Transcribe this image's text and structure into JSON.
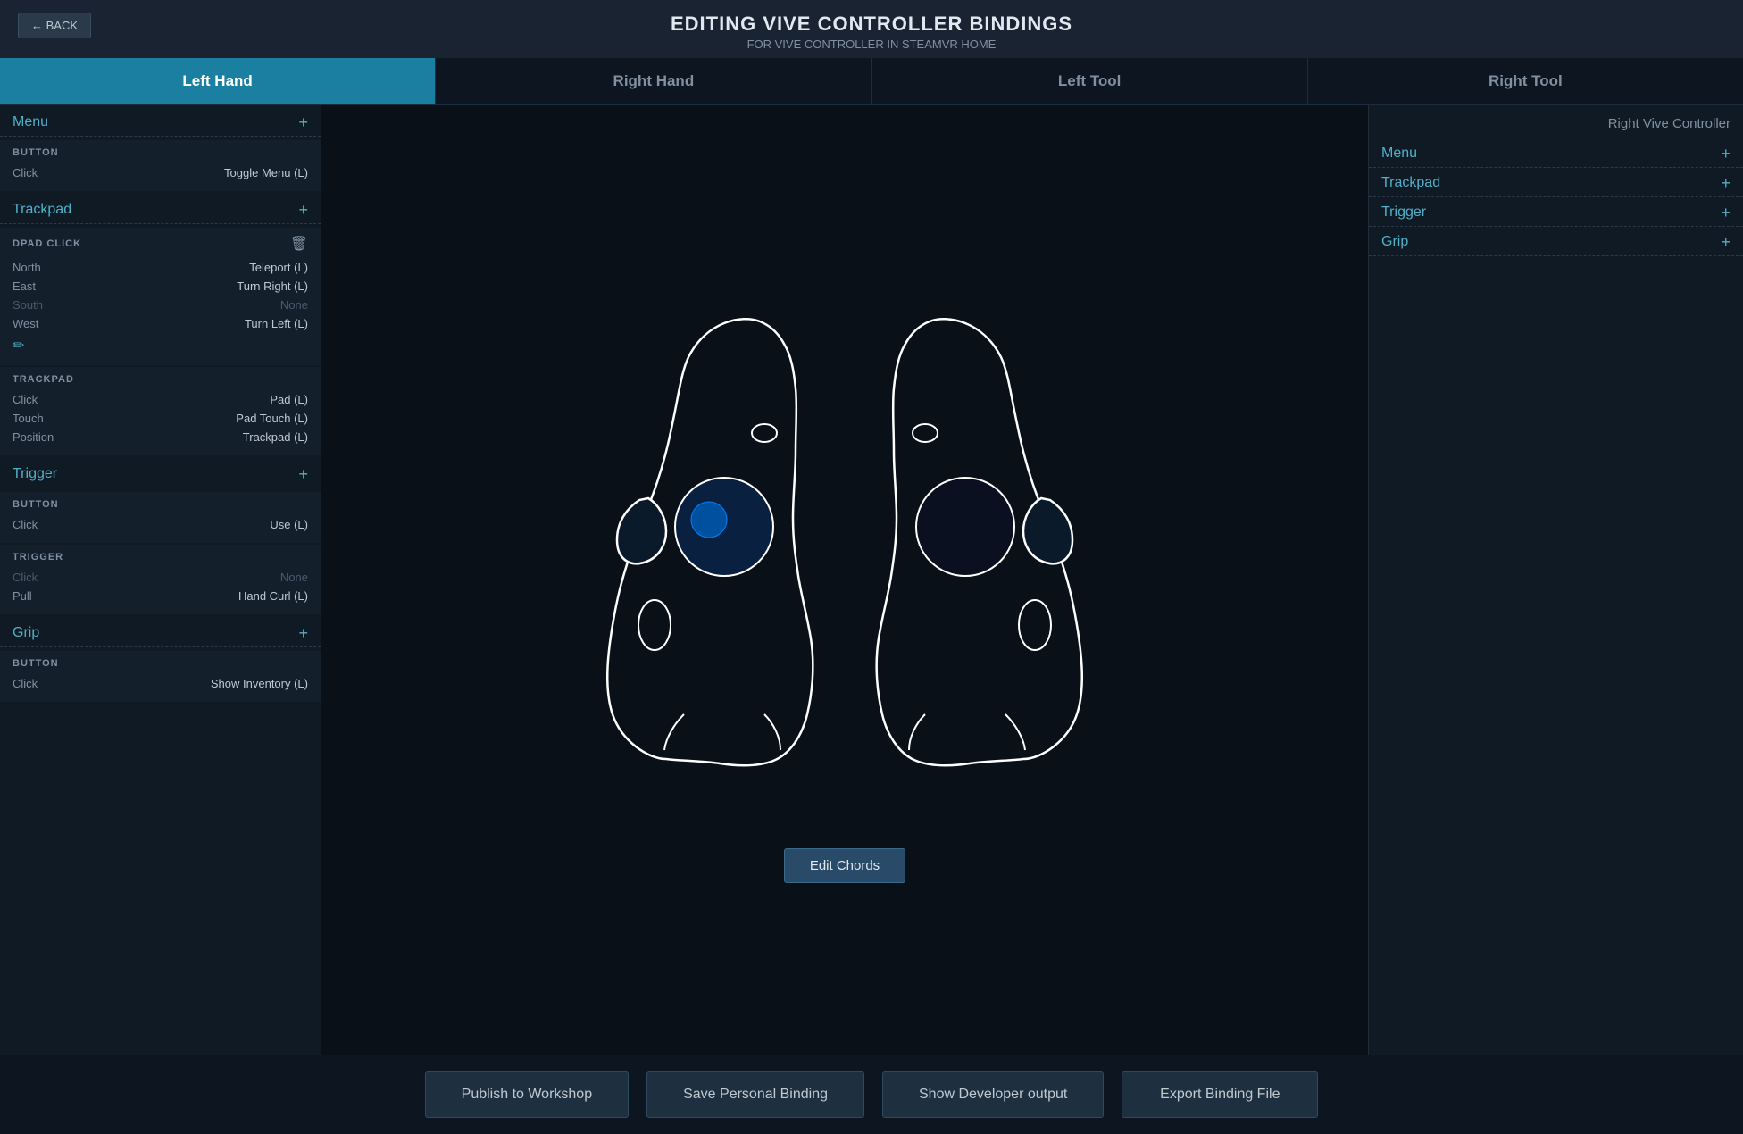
{
  "header": {
    "title": "EDITING VIVE CONTROLLER BINDINGS",
    "subtitle": "FOR VIVE CONTROLLER IN STEAMVR HOME",
    "back_label": "← BACK"
  },
  "tabs": [
    {
      "id": "left-hand",
      "label": "Left Hand",
      "active": true
    },
    {
      "id": "right-hand",
      "label": "Right Hand",
      "active": false
    },
    {
      "id": "left-tool",
      "label": "Left Tool",
      "active": false
    },
    {
      "id": "right-tool",
      "label": "Right Tool",
      "active": false
    }
  ],
  "left_panel": {
    "sections": [
      {
        "id": "menu",
        "title": "Menu",
        "groups": [
          {
            "label": "BUTTON",
            "deletable": false,
            "bindings": [
              {
                "key": "Click",
                "value": "Toggle Menu (L)",
                "dim": false
              }
            ]
          }
        ]
      },
      {
        "id": "trackpad",
        "title": "Trackpad",
        "groups": [
          {
            "label": "DPAD CLICK",
            "deletable": true,
            "has_edit": true,
            "bindings": [
              {
                "key": "North",
                "value": "Teleport (L)",
                "dim": false
              },
              {
                "key": "East",
                "value": "Turn Right (L)",
                "dim": false
              },
              {
                "key": "South",
                "value": "None",
                "dim": true
              },
              {
                "key": "West",
                "value": "Turn Left (L)",
                "dim": false
              }
            ]
          },
          {
            "label": "TRACKPAD",
            "deletable": false,
            "bindings": [
              {
                "key": "Click",
                "value": "Pad (L)",
                "dim": false
              },
              {
                "key": "Touch",
                "value": "Pad Touch (L)",
                "dim": false
              },
              {
                "key": "Position",
                "value": "Trackpad (L)",
                "dim": false
              }
            ]
          }
        ]
      },
      {
        "id": "trigger",
        "title": "Trigger",
        "groups": [
          {
            "label": "BUTTON",
            "deletable": false,
            "bindings": [
              {
                "key": "Click",
                "value": "Use (L)",
                "dim": false
              }
            ]
          },
          {
            "label": "TRIGGER",
            "deletable": false,
            "bindings": [
              {
                "key": "Click",
                "value": "None",
                "dim": true
              },
              {
                "key": "Pull",
                "value": "Hand Curl (L)",
                "dim": false
              }
            ]
          }
        ]
      },
      {
        "id": "grip",
        "title": "Grip",
        "groups": [
          {
            "label": "BUTTON",
            "deletable": false,
            "bindings": [
              {
                "key": "Click",
                "value": "Show Inventory (L)",
                "dim": false
              }
            ]
          }
        ]
      }
    ]
  },
  "right_panel": {
    "title": "Right Vive Controller",
    "sections": [
      {
        "title": "Menu"
      },
      {
        "title": "Trackpad"
      },
      {
        "title": "Trigger"
      },
      {
        "title": "Grip"
      }
    ]
  },
  "center": {
    "edit_chords_label": "Edit Chords"
  },
  "footer": {
    "buttons": [
      {
        "id": "publish",
        "label": "Publish to Workshop"
      },
      {
        "id": "save",
        "label": "Save Personal Binding"
      },
      {
        "id": "developer",
        "label": "Show Developer output"
      },
      {
        "id": "export",
        "label": "Export Binding File"
      }
    ]
  }
}
